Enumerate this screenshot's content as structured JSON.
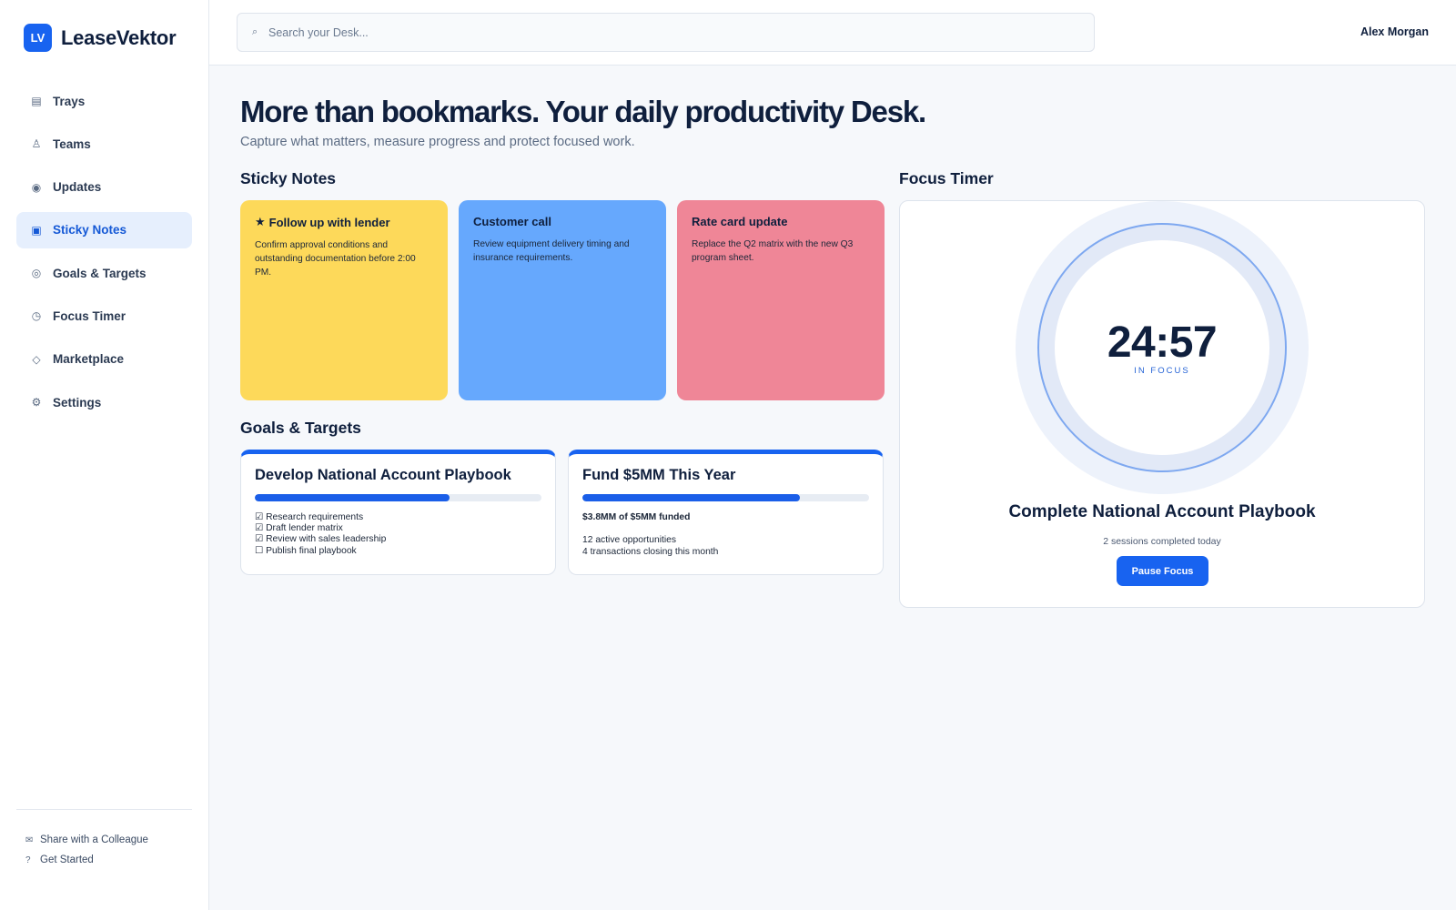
{
  "brand": {
    "logo_text": "LV",
    "name": "LeaseVektor"
  },
  "sidebar": {
    "items": [
      {
        "label": "Trays",
        "icon": "tray-icon",
        "glyph": "▤"
      },
      {
        "label": "Teams",
        "icon": "teams-icon",
        "glyph": "♙"
      },
      {
        "label": "Updates",
        "icon": "updates-icon",
        "glyph": "◉"
      },
      {
        "label": "Sticky Notes",
        "icon": "sticky-note-icon",
        "glyph": "▣",
        "active": true
      },
      {
        "label": "Goals & Targets",
        "icon": "target-icon",
        "glyph": "◎"
      },
      {
        "label": "Focus Timer",
        "icon": "timer-icon",
        "glyph": "◷"
      },
      {
        "label": "Marketplace",
        "icon": "marketplace-icon",
        "glyph": "◇"
      },
      {
        "label": "Settings",
        "icon": "gear-icon",
        "glyph": "⚙"
      }
    ],
    "footer": [
      {
        "label": "Share with a Colleague",
        "icon": "mail-icon",
        "glyph": "✉"
      },
      {
        "label": "Get Started",
        "icon": "help-icon",
        "glyph": "?"
      }
    ]
  },
  "header": {
    "search_placeholder": "Search your Desk...",
    "search_glyph": "⌕",
    "user_name": "Alex Morgan"
  },
  "hero": {
    "title": "More than bookmarks. Your daily productivity Desk.",
    "subtitle": "Capture what matters, measure progress and protect focused work."
  },
  "sticky_notes": {
    "section_title": "Sticky Notes",
    "notes": [
      {
        "title": "Follow up with lender",
        "starred": true,
        "star_glyph": "★",
        "color": "#fdd95a",
        "body": "Confirm approval conditions and outstanding documentation before 2:00 PM."
      },
      {
        "title": "Customer call",
        "starred": false,
        "color": "#66a8fd",
        "body": "Review equipment delivery timing and insurance requirements."
      },
      {
        "title": "Rate card update",
        "starred": false,
        "color": "#ef8697",
        "body": "Replace the Q2 matrix with the new Q3 program sheet."
      }
    ]
  },
  "goals": {
    "section_title": "Goals & Targets",
    "cards": [
      {
        "title": "Develop National Account Playbook",
        "progress": 0.68,
        "checklist": [
          {
            "text": "Research requirements",
            "done": true
          },
          {
            "text": "Draft lender matrix",
            "done": true
          },
          {
            "text": "Review with sales leadership",
            "done": true
          },
          {
            "text": "Publish final playbook",
            "done": false
          }
        ]
      },
      {
        "title": "Fund $5MM This Year",
        "progress": 0.76,
        "funded": "$3.8MM of $5MM funded",
        "stats": [
          "12 active opportunities",
          "4 transactions closing this month"
        ]
      }
    ]
  },
  "focus_timer": {
    "section_title": "Focus Timer",
    "time": "24:57",
    "status": "IN FOCUS",
    "task": "Complete National Account Playbook",
    "sessions": "2 sessions completed today",
    "button_label": "Pause Focus",
    "accent": "#1863f0"
  }
}
